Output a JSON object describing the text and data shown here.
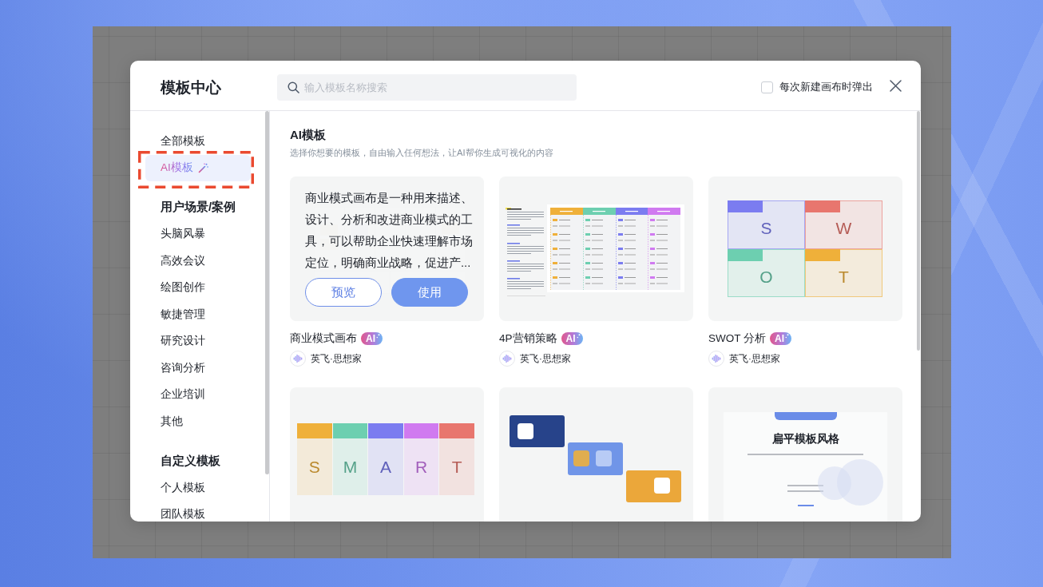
{
  "header": {
    "title": "模板中心",
    "search": {
      "placeholder": "输入模板名称搜索"
    },
    "popup_option": {
      "label": "每次新建画布时弹出",
      "checked": false
    }
  },
  "sidebar": {
    "sections": [
      {
        "items": [
          {
            "label": "全部模板",
            "kind": "plain",
            "selected": false,
            "outlined": false
          },
          {
            "label": "AI模板",
            "kind": "ai",
            "selected": true,
            "outlined": true
          }
        ]
      },
      {
        "heading": "用户场景/案例",
        "items": [
          {
            "label": "头脑风暴",
            "kind": "plain",
            "selected": false,
            "outlined": false
          },
          {
            "label": "高效会议",
            "kind": "plain",
            "selected": false,
            "outlined": false
          },
          {
            "label": "绘图创作",
            "kind": "plain",
            "selected": false,
            "outlined": false
          },
          {
            "label": "敏捷管理",
            "kind": "plain",
            "selected": false,
            "outlined": false
          },
          {
            "label": "研究设计",
            "kind": "plain",
            "selected": false,
            "outlined": false
          },
          {
            "label": "咨询分析",
            "kind": "plain",
            "selected": false,
            "outlined": false
          },
          {
            "label": "企业培训",
            "kind": "plain",
            "selected": false,
            "outlined": false
          },
          {
            "label": "其他",
            "kind": "plain",
            "selected": false,
            "outlined": false
          }
        ]
      },
      {
        "heading": "自定义模板",
        "items": [
          {
            "label": "个人模板",
            "kind": "plain",
            "selected": false,
            "outlined": false
          },
          {
            "label": "团队模板",
            "kind": "plain",
            "selected": false,
            "outlined": false
          }
        ]
      }
    ]
  },
  "content": {
    "title": "AI模板",
    "subtitle": "选择你想要的模板，自由输入任何想法，让AI帮你生成可视化的内容",
    "cards": [
      {
        "kind": "canvas",
        "hovered": true,
        "description": "商业模式画布是一种用来描述、设计、分析和改进商业模式的工具，可以帮助企业快速理解市场定位，明确商业战略，促进产...",
        "actions": [
          {
            "label": "预览",
            "kind": "outline"
          },
          {
            "label": "使用",
            "kind": "primary"
          }
        ],
        "title": "商业模式画布",
        "badge": "AI",
        "author": "英飞·思想家"
      },
      {
        "kind": "table",
        "hovered": false,
        "title": "4P营销策略",
        "badge": "AI",
        "author": "英飞·思想家"
      },
      {
        "kind": "swot",
        "hovered": false,
        "letters": [
          {
            "letter": "S",
            "color": "#7b7cf0"
          },
          {
            "letter": "W",
            "color": "#e8766e"
          },
          {
            "letter": "O",
            "color": "#6dcfb0"
          },
          {
            "letter": "T",
            "color": "#efb03a"
          }
        ],
        "title": "SWOT 分析",
        "badge": "AI",
        "author": "英飞·思想家"
      },
      {
        "kind": "smart",
        "hovered": false,
        "letters": [
          {
            "letter": "S",
            "color": "#efb03a"
          },
          {
            "letter": "M",
            "color": "#6dcfb0"
          },
          {
            "letter": "A",
            "color": "#7b7cf0"
          },
          {
            "letter": "R",
            "color": "#d07af0"
          },
          {
            "letter": "T",
            "color": "#e8766e"
          }
        ]
      },
      {
        "kind": "blocks",
        "hovered": false
      },
      {
        "kind": "slide",
        "hovered": false,
        "heading": "扁平模板风格"
      }
    ]
  }
}
